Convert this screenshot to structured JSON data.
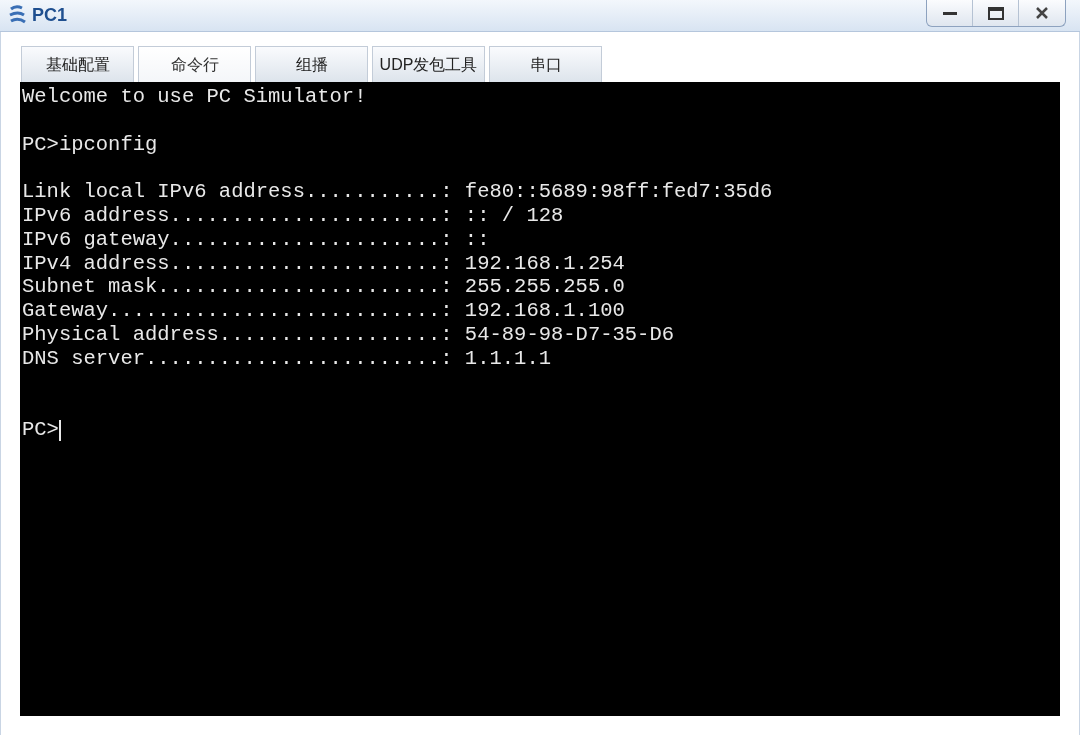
{
  "window": {
    "title": "PC1"
  },
  "tabs": [
    {
      "label": "基础配置",
      "selected": false
    },
    {
      "label": "命令行",
      "selected": true
    },
    {
      "label": "组播",
      "selected": false
    },
    {
      "label": "UDP发包工具",
      "selected": false
    },
    {
      "label": "串口",
      "selected": false
    }
  ],
  "terminal": {
    "lines": [
      {
        "kind": "text",
        "text": "Welcome to use PC Simulator!"
      },
      {
        "kind": "blank"
      },
      {
        "kind": "text",
        "text": "PC>ipconfig"
      },
      {
        "kind": "blank"
      },
      {
        "kind": "text",
        "text": "Link local IPv6 address...........: fe80::5689:98ff:fed7:35d6"
      },
      {
        "kind": "text",
        "text": "IPv6 address......................: :: / 128"
      },
      {
        "kind": "text",
        "text": "IPv6 gateway......................: ::"
      },
      {
        "kind": "text",
        "text": "IPv4 address......................: 192.168.1.254"
      },
      {
        "kind": "text",
        "text": "Subnet mask.......................: 255.255.255.0"
      },
      {
        "kind": "text",
        "text": "Gateway...........................: 192.168.1.100"
      },
      {
        "kind": "text",
        "text": "Physical address..................: 54-89-98-D7-35-D6"
      },
      {
        "kind": "text",
        "text": "DNS server........................: 1.1.1.1"
      },
      {
        "kind": "blank"
      },
      {
        "kind": "blank"
      },
      {
        "kind": "prompt",
        "text": "PC>"
      }
    ]
  }
}
